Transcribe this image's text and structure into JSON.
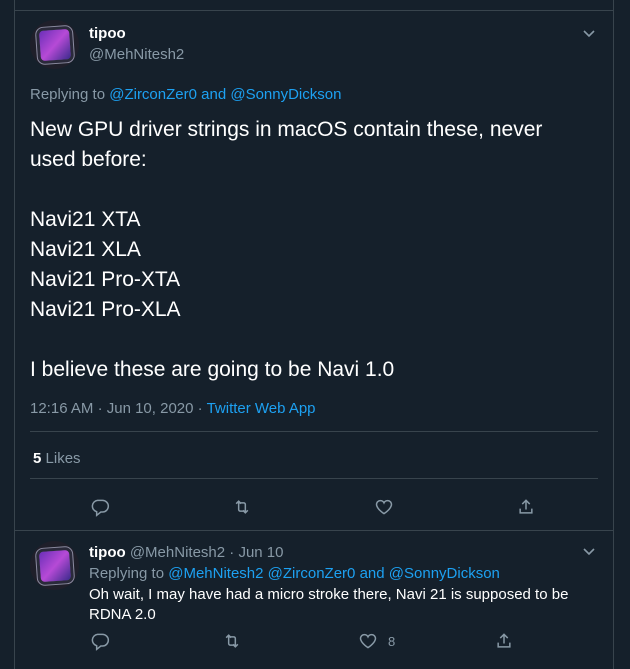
{
  "tweet": {
    "display_name": "tipoo",
    "handle": "@MehNitesh2",
    "replying_prefix": "Replying to",
    "replying_to_1": "@ZirconZer0",
    "replying_and": "and",
    "replying_to_2": "@SonnyDickson",
    "text": "New GPU driver strings in macOS contain these, never used before:\n\nNavi21 XTA\nNavi21 XLA\nNavi21 Pro-XTA\nNavi21 Pro-XLA\n\nI believe these are going to be Navi 1.0",
    "time": "12:16 AM",
    "dot": "·",
    "date": "Jun 10, 2020",
    "app": "Twitter Web App",
    "likes_count": "5",
    "likes_label": "Likes"
  },
  "reply": {
    "display_name": "tipoo",
    "handle": "@MehNitesh2",
    "dot": "·",
    "date": "Jun 10",
    "replying_prefix": "Replying to",
    "mentions": "@MehNitesh2 @ZirconZer0",
    "replying_and": "and",
    "replying_to_last": "@SonnyDickson",
    "text": "Oh wait, I may have had a micro stroke there, Navi 21 is supposed to be RDNA 2.0",
    "like_count": "8"
  },
  "icons": {
    "caret": "chevron-down-icon",
    "reply": "reply-icon",
    "retweet": "retweet-icon",
    "like": "heart-icon",
    "share": "share-icon"
  },
  "colors": {
    "background": "#15202b",
    "border": "#38444d",
    "secondary_text": "#8899a6",
    "link": "#1da1f2"
  }
}
